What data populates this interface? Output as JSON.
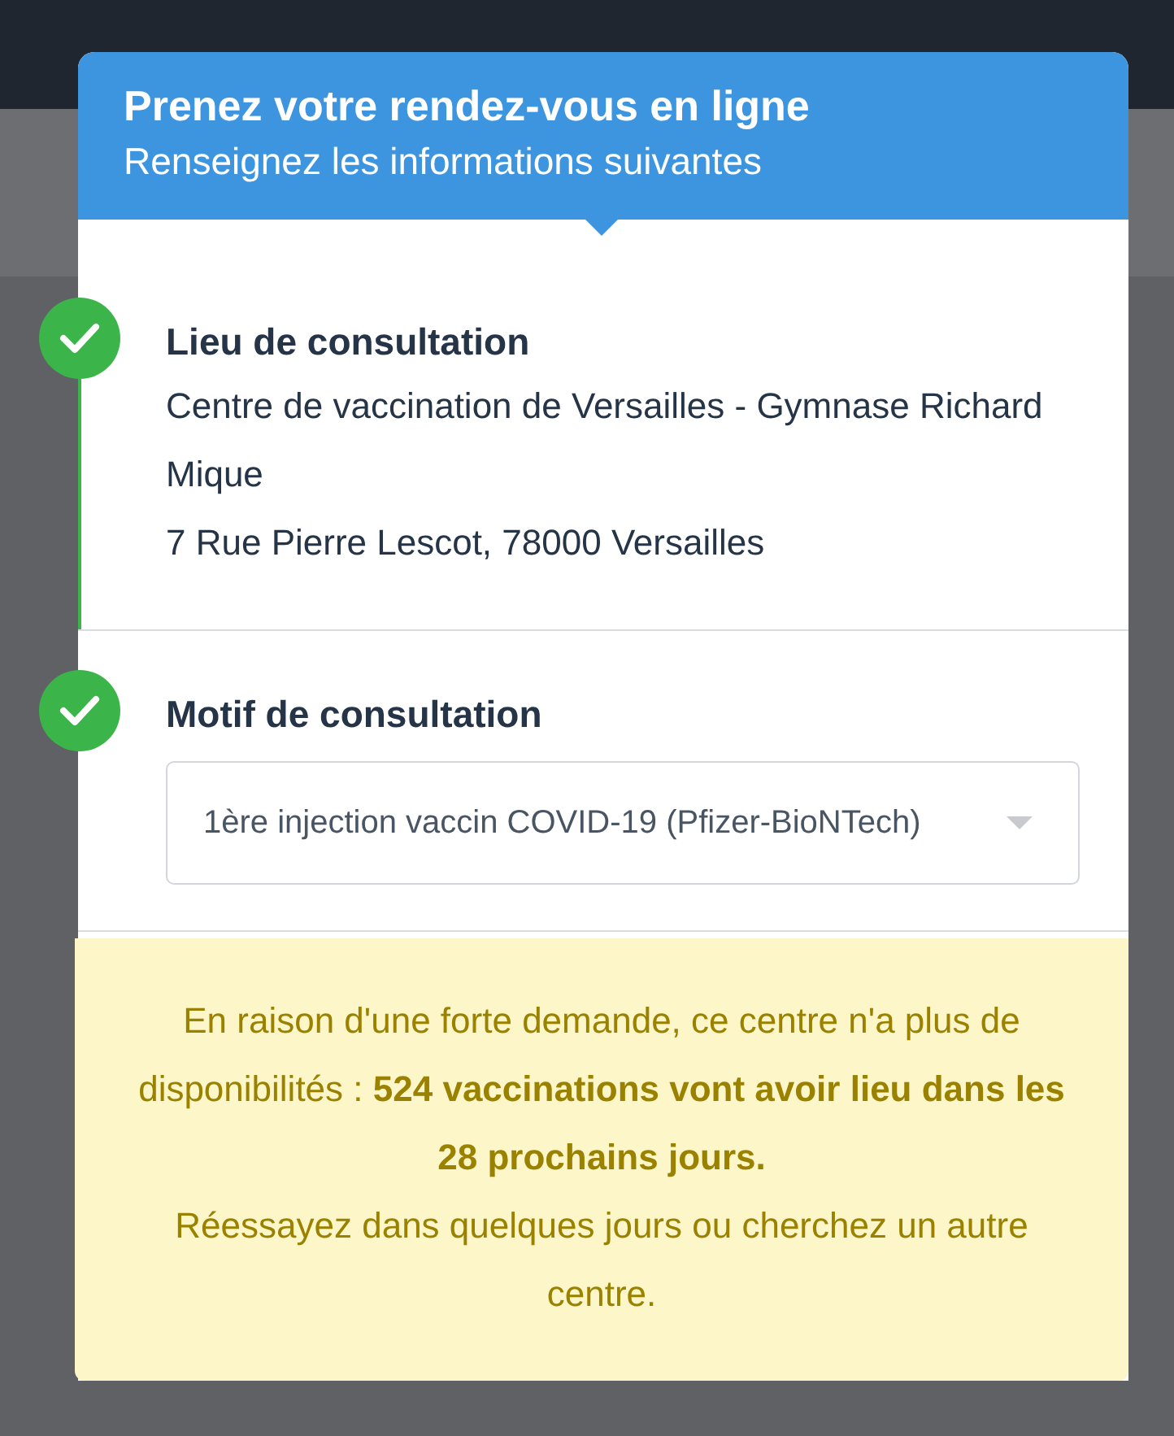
{
  "header": {
    "title": "Prenez votre rendez-vous en ligne",
    "subtitle": "Renseignez les informations suivantes"
  },
  "steps": [
    {
      "kind": "text",
      "title": "Lieu de consultation",
      "completed": true,
      "lines": [
        "Centre de vaccination de Versailles - Gymnase Richard Mique",
        "7 Rue Pierre Lescot, 78000 Versailles"
      ]
    },
    {
      "kind": "select",
      "title": "Motif de consultation",
      "completed": true,
      "value": "1ère injection vaccin COVID-19 (Pfizer-BioNTech)"
    }
  ],
  "notice": {
    "paragraphs": [
      "En raison d'une forte demande, ce centre n'a plus de disponibilités : **524 vaccinations vont avoir lieu dans les 28 prochains jours.**",
      "Réessayez dans quelques jours ou cherchez un autre centre."
    ]
  }
}
